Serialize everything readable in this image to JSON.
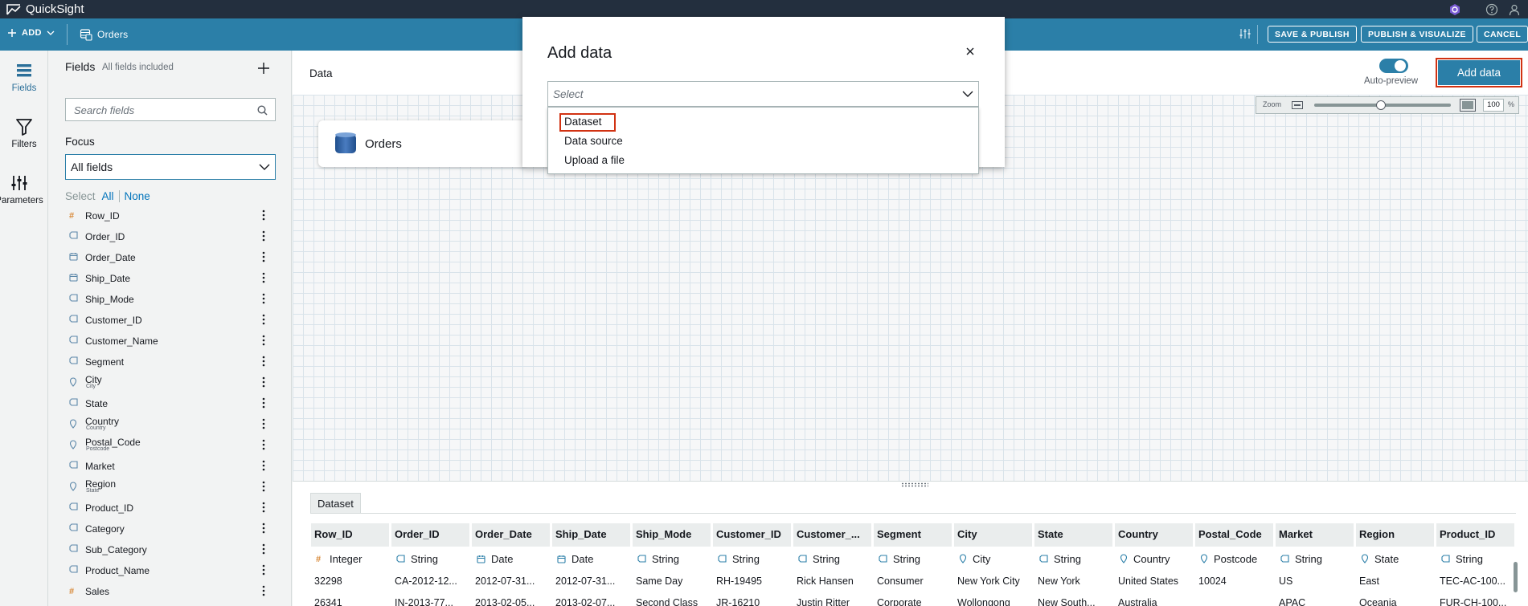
{
  "app": {
    "title": "QuickSight"
  },
  "toolbar": {
    "add_label": "ADD",
    "dataset_name": "Orders",
    "save_publish": "SAVE & PUBLISH",
    "publish_visualize": "PUBLISH & VISUALIZE",
    "cancel": "CANCEL"
  },
  "rail": {
    "fields": "Fields",
    "filters": "Filters",
    "parameters": "Parameters"
  },
  "fields_panel": {
    "title": "Fields",
    "subtitle": "All fields included",
    "search_placeholder": "Search fields",
    "focus_label": "Focus",
    "focus_value": "All fields",
    "select_label": "Select",
    "select_all": "All",
    "select_none": "None",
    "fields": [
      {
        "name": "Row_ID",
        "icon": "number-icon",
        "sub": ""
      },
      {
        "name": "Order_ID",
        "icon": "string-icon",
        "sub": ""
      },
      {
        "name": "Order_Date",
        "icon": "date-icon",
        "sub": ""
      },
      {
        "name": "Ship_Date",
        "icon": "date-icon",
        "sub": ""
      },
      {
        "name": "Ship_Mode",
        "icon": "string-icon",
        "sub": ""
      },
      {
        "name": "Customer_ID",
        "icon": "string-icon",
        "sub": ""
      },
      {
        "name": "Customer_Name",
        "icon": "string-icon",
        "sub": ""
      },
      {
        "name": "Segment",
        "icon": "string-icon",
        "sub": ""
      },
      {
        "name": "City",
        "icon": "geo-icon",
        "sub": "City"
      },
      {
        "name": "State",
        "icon": "string-icon",
        "sub": ""
      },
      {
        "name": "Country",
        "icon": "geo-icon",
        "sub": "Country"
      },
      {
        "name": "Postal_Code",
        "icon": "geo-icon",
        "sub": "Postcode"
      },
      {
        "name": "Market",
        "icon": "string-icon",
        "sub": ""
      },
      {
        "name": "Region",
        "icon": "geo-icon",
        "sub": "State"
      },
      {
        "name": "Product_ID",
        "icon": "string-icon",
        "sub": ""
      },
      {
        "name": "Category",
        "icon": "string-icon",
        "sub": ""
      },
      {
        "name": "Sub_Category",
        "icon": "string-icon",
        "sub": ""
      },
      {
        "name": "Product_Name",
        "icon": "string-icon",
        "sub": ""
      },
      {
        "name": "Sales",
        "icon": "number-icon",
        "sub": ""
      }
    ]
  },
  "canvas": {
    "header": "Data",
    "node_label": "Orders",
    "auto_preview_label": "Auto-preview",
    "add_data_button": "Add data",
    "zoom_label": "Zoom",
    "zoom_value": "100",
    "zoom_unit": "%"
  },
  "preview": {
    "tab": "Dataset",
    "columns": [
      {
        "name": "Row_ID",
        "type": "Integer",
        "icon": "number-icon"
      },
      {
        "name": "Order_ID",
        "type": "String",
        "icon": "string-icon"
      },
      {
        "name": "Order_Date",
        "type": "Date",
        "icon": "date-icon"
      },
      {
        "name": "Ship_Date",
        "type": "Date",
        "icon": "date-icon"
      },
      {
        "name": "Ship_Mode",
        "type": "String",
        "icon": "string-icon"
      },
      {
        "name": "Customer_ID",
        "type": "String",
        "icon": "string-icon"
      },
      {
        "name": "Customer_...",
        "type": "String",
        "icon": "string-icon"
      },
      {
        "name": "Segment",
        "type": "String",
        "icon": "string-icon"
      },
      {
        "name": "City",
        "type": "City",
        "icon": "geo-icon"
      },
      {
        "name": "State",
        "type": "String",
        "icon": "string-icon"
      },
      {
        "name": "Country",
        "type": "Country",
        "icon": "geo-icon"
      },
      {
        "name": "Postal_Code",
        "type": "Postcode",
        "icon": "geo-icon"
      },
      {
        "name": "Market",
        "type": "String",
        "icon": "string-icon"
      },
      {
        "name": "Region",
        "type": "State",
        "icon": "geo-icon"
      },
      {
        "name": "Product_ID",
        "type": "String",
        "icon": "string-icon"
      }
    ],
    "rows": [
      [
        "32298",
        "CA-2012-12...",
        "2012-07-31...",
        "2012-07-31...",
        "Same Day",
        "RH-19495",
        "Rick Hansen",
        "Consumer",
        "New York City",
        "New York",
        "United States",
        "10024",
        "US",
        "East",
        "TEC-AC-100..."
      ],
      [
        "26341",
        "IN-2013-77...",
        "2013-02-05...",
        "2013-02-07...",
        "Second Class",
        "JR-16210",
        "Justin Ritter",
        "Corporate",
        "Wollongong",
        "New South...",
        "Australia",
        "",
        "APAC",
        "Oceania",
        "FUR-CH-100..."
      ]
    ]
  },
  "modal": {
    "title": "Add data",
    "select_placeholder": "Select",
    "options": [
      "Dataset",
      "Data source",
      "Upload a file"
    ]
  },
  "colors": {
    "toolbar": "#2b7fa8",
    "topbar": "#232f3e",
    "highlight": "#d13212",
    "link": "#0073bb"
  }
}
